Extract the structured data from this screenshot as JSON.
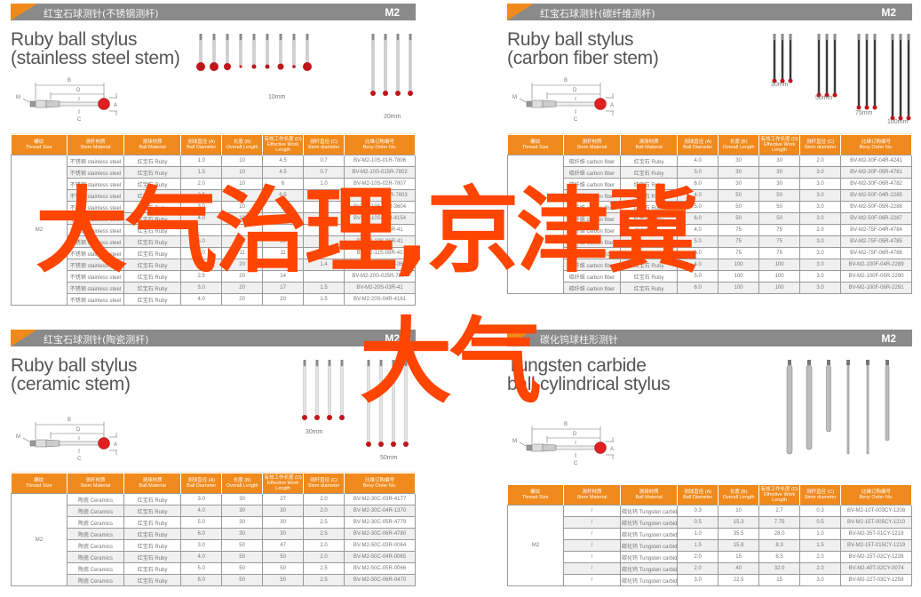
{
  "columns": [
    {
      "cn": "螺纹",
      "en": "Thread Size"
    },
    {
      "cn": "测杆材质",
      "en": "Stem Material"
    },
    {
      "cn": "测球材质",
      "en": "Ball Material"
    },
    {
      "cn": "测球直径 (A)",
      "en": "Ball Diameter"
    },
    {
      "cn": "长度 (B)",
      "en": "Overall Length"
    },
    {
      "cn": "有效工作长度 (D)",
      "en": "Effective Work Length"
    },
    {
      "cn": "测杆直径 (C)",
      "en": "Stem diameter"
    },
    {
      "cn": "比维订购编号",
      "en": "Bevy Order No."
    }
  ],
  "diagram_labels": {
    "b": "B",
    "d": "D",
    "m": "M",
    "a": "A",
    "c": "C"
  },
  "overlay": {
    "line1": "大气治理,京津冀",
    "line2": "大气"
  },
  "panels": [
    {
      "id": "stainless",
      "header_cn": "红宝石球测针(不锈钢测杆)",
      "code": "M2",
      "title_line1": "Ruby ball stylus",
      "title_line2": "(stainless steel stem)",
      "photo_labels": [
        "10mm",
        "20mm"
      ],
      "thread": "M2",
      "rows": [
        [
          "不锈钢 stainless steel",
          "红宝石 Ruby",
          "1.0",
          "10",
          "4.5",
          "0.7",
          "BV-M2-10S-01R-7806"
        ],
        [
          "不锈钢 stainless steel",
          "红宝石 Ruby",
          "1.5",
          "10",
          "4.5",
          "0.7",
          "BV-M2-10S-015R-7802"
        ],
        [
          "不锈钢 stainless steel",
          "红宝石 Ruby",
          "2.0",
          "10",
          "6",
          "1.0",
          "BV-M2-10S-02R-7807"
        ],
        [
          "不锈钢 stainless steel",
          "红宝石 Ruby",
          "2.5",
          "10",
          "6.5",
          "1.0",
          "BV-M2-10S-025R-7803"
        ],
        [
          "不锈钢 stainless steel",
          "红宝石 Ruby",
          "3.0",
          "10",
          "7",
          "1.5",
          "BV-M2-10S-03R-3604"
        ],
        [
          "不锈钢 stainless steel",
          "红宝石 Ruby",
          "4.0",
          "10",
          "10",
          "1.5",
          "BV-M2-10S-04R-4154"
        ],
        [
          "不锈钢 stainless steel",
          "红宝石 Ruby",
          "",
          "",
          "",
          "2.5",
          "BV-M2-10S-05R-41"
        ],
        [
          "不锈钢 stainless steel",
          "红宝石 Ruby",
          "6.0",
          "10",
          "10",
          "2.5",
          "BV-M2-10S-06R-41"
        ],
        [
          "不锈钢 stainless steel",
          "红宝石 Ruby",
          "8.0",
          "11",
          "11",
          "",
          "BV-M2-11S-08R-41"
        ],
        [
          "不锈钢 stainless steel",
          "红宝石 Ruby",
          "",
          "20",
          "14",
          "1.4",
          "BV-M2-20S-02R-36"
        ],
        [
          "不锈钢 stainless steel",
          "红宝石 Ruby",
          "2.5",
          "20",
          "14",
          "",
          "BV-M2-20S-025R-7804"
        ],
        [
          "不锈钢 stainless steel",
          "红宝石 Ruby",
          "3.0",
          "20",
          "17",
          "1.5",
          "BV-M2-20S-03R-41"
        ],
        [
          "不锈钢 stainless steel",
          "红宝石 Ruby",
          "4.0",
          "20",
          "20",
          "1.5",
          "BV-M2-20S-04R-4161"
        ]
      ]
    },
    {
      "id": "carbon",
      "header_cn": "红宝石球测针(碳纤维测杆)",
      "code": "M2",
      "title_line1": "Ruby ball stylus",
      "title_line2": "(carbon fiber stem)",
      "photo_labels": [
        "30mm",
        "50mm",
        "75mm",
        "100mm"
      ],
      "thread": "M2",
      "rows": [
        [
          "碳纤维 carbon fiber",
          "红宝石 Ruby",
          "4.0",
          "30",
          "30",
          "2.0",
          "BV-M2-30F-04R-4241"
        ],
        [
          "碳纤维 carbon fiber",
          "红宝石 Ruby",
          "5.0",
          "30",
          "30",
          "3.0",
          "BV-M2-30F-05R-4781"
        ],
        [
          "碳纤维 carbon fiber",
          "红宝石 Ruby",
          "6.0",
          "30",
          "30",
          "3.0",
          "BV-M2-30F-06R-4782"
        ],
        [
          "碳纤维 carbon fiber",
          "红宝石 Ruby",
          "4.0",
          "50",
          "50",
          "3.0",
          "BV-M2-50F-04R-2285"
        ],
        [
          "碳纤维 carbon fiber",
          "红宝石 Ruby",
          "5.0",
          "50",
          "50",
          "3.0",
          "BV-M2-50F-05R-2286"
        ],
        [
          "碳纤维 carbon fiber",
          "红宝石 Ruby",
          "6.0",
          "50",
          "50",
          "3.0",
          "BV-M2-50F-06R-2287"
        ],
        [
          "碳纤维 carbon fiber",
          "红宝石 Ruby",
          "4.0",
          "75",
          "75",
          "2.0",
          "BV-M2-75F-04R-4784"
        ],
        [
          "碳纤维 carbon fiber",
          "红宝石 Ruby",
          "5.0",
          "75",
          "75",
          "3.0",
          "BV-M2-75F-05R-4785"
        ],
        [
          "碳纤维 carbon fiber",
          "红宝石 Ruby",
          "6.0",
          "75",
          "75",
          "3.0",
          "BV-M2-75F-06R-4786"
        ],
        [
          "碳纤维 carbon fiber",
          "红宝石 Ruby",
          "4.0",
          "100",
          "100",
          "3.0",
          "BV-M2-100F-04R-2289"
        ],
        [
          "碳纤维 carbon fiber",
          "红宝石 Ruby",
          "5.0",
          "100",
          "100",
          "3.0",
          "BV-M2-100F-05R-2290"
        ],
        [
          "碳纤维 carbon fiber",
          "红宝石 Ruby",
          "6.0",
          "100",
          "100",
          "3.0",
          "BV-M2-100F-06R-2291"
        ]
      ]
    },
    {
      "id": "ceramic",
      "header_cn": "红宝石球测针(陶瓷测杆)",
      "code": "M2",
      "title_line1": "Ruby ball stylus",
      "title_line2": "(ceramic stem)",
      "photo_labels": [
        "30mm",
        "50mm"
      ],
      "thread": "M2",
      "rows": [
        [
          "陶瓷 Ceramics",
          "红宝石 Ruby",
          "3.0",
          "30",
          "27",
          "2.0",
          "BV-M2-30C-03R-4177"
        ],
        [
          "陶瓷 Ceramics",
          "红宝石 Ruby",
          "4.0",
          "30",
          "30",
          "2.0",
          "BV-M2-30C-04R-1370"
        ],
        [
          "陶瓷 Ceramics",
          "红宝石 Ruby",
          "5.0",
          "30",
          "30",
          "2.5",
          "BV-M2-30C-05R-4779"
        ],
        [
          "陶瓷 Ceramics",
          "红宝石 Ruby",
          "6.0",
          "30",
          "30",
          "2.5",
          "BV-M2-30C-06R-4780"
        ],
        [
          "陶瓷 Ceramics",
          "红宝石 Ruby",
          "3.0",
          "50",
          "47",
          "2.0",
          "BV-M2-50C-03R-0064"
        ],
        [
          "陶瓷 Ceramics",
          "红宝石 Ruby",
          "4.0",
          "50",
          "50",
          "2.0",
          "BV-M2-50C-04R-0065"
        ],
        [
          "陶瓷 Ceramics",
          "红宝石 Ruby",
          "5.0",
          "50",
          "50",
          "2.5",
          "BV-M2-50C-05R-0066"
        ],
        [
          "陶瓷 Ceramics",
          "红宝石 Ruby",
          "6.0",
          "50",
          "50",
          "2.5",
          "BV-M2-50C-06R-0470"
        ]
      ]
    },
    {
      "id": "tungsten",
      "header_cn": "碳化钨球柱形测针",
      "code": "M2",
      "title_line1": "Tungsten carbide",
      "title_line2": "ball cylindrical stylus",
      "photo_labels": [],
      "thread": "M2",
      "rows": [
        [
          "/",
          "碳化钨 Tungsten carbide",
          "0.3",
          "10",
          "2.7",
          "0.3",
          "BV-M2-10T-003CY-1208"
        ],
        [
          "/",
          "碳化钨 Tungsten carbide",
          "0.5",
          "15.3",
          "7.75",
          "0.5",
          "BV-M2-15T-005CY-1210"
        ],
        [
          "/",
          "碳化钨 Tungsten carbide",
          "1.0",
          "35.5",
          "28.0",
          "1.0",
          "BV-M2-35T-01CY-1218"
        ],
        [
          "/",
          "碳化钨 Tungsten carbide",
          "1.5",
          "15.8",
          "8.3",
          "1.5",
          "BV-M2-15T-015CY-1219"
        ],
        [
          "/",
          "碳化钨 Tungsten carbide",
          "2.0",
          "15",
          "8.5",
          "2.0",
          "BV-M2-15T-02CY-1228"
        ],
        [
          "/",
          "碳化钨 Tungsten carbide",
          "2.0",
          "40",
          "32.0",
          "2.0",
          "BV-M2-40T-02CY-0074"
        ],
        [
          "/",
          "碳化钨 Tungsten carbide",
          "3.0",
          "22.5",
          "15",
          "3.0",
          "BV-M2-22T-03CY-1258"
        ]
      ]
    }
  ]
}
